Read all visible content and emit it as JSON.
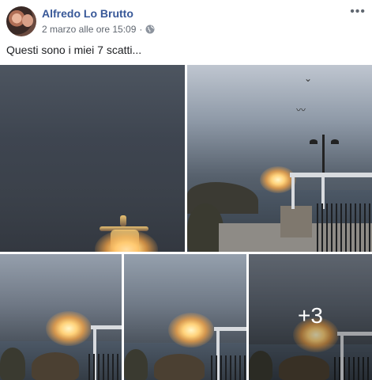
{
  "post": {
    "author": "Alfredo Lo Brutto",
    "timestamp": "2 marzo alle ore 15:09",
    "privacy_icon": "globe-icon",
    "more_icon": "ellipsis-icon",
    "more_label": "•••",
    "caption": "Questi sono i miei 7 scatti...",
    "photos_extra_count": "+3"
  }
}
